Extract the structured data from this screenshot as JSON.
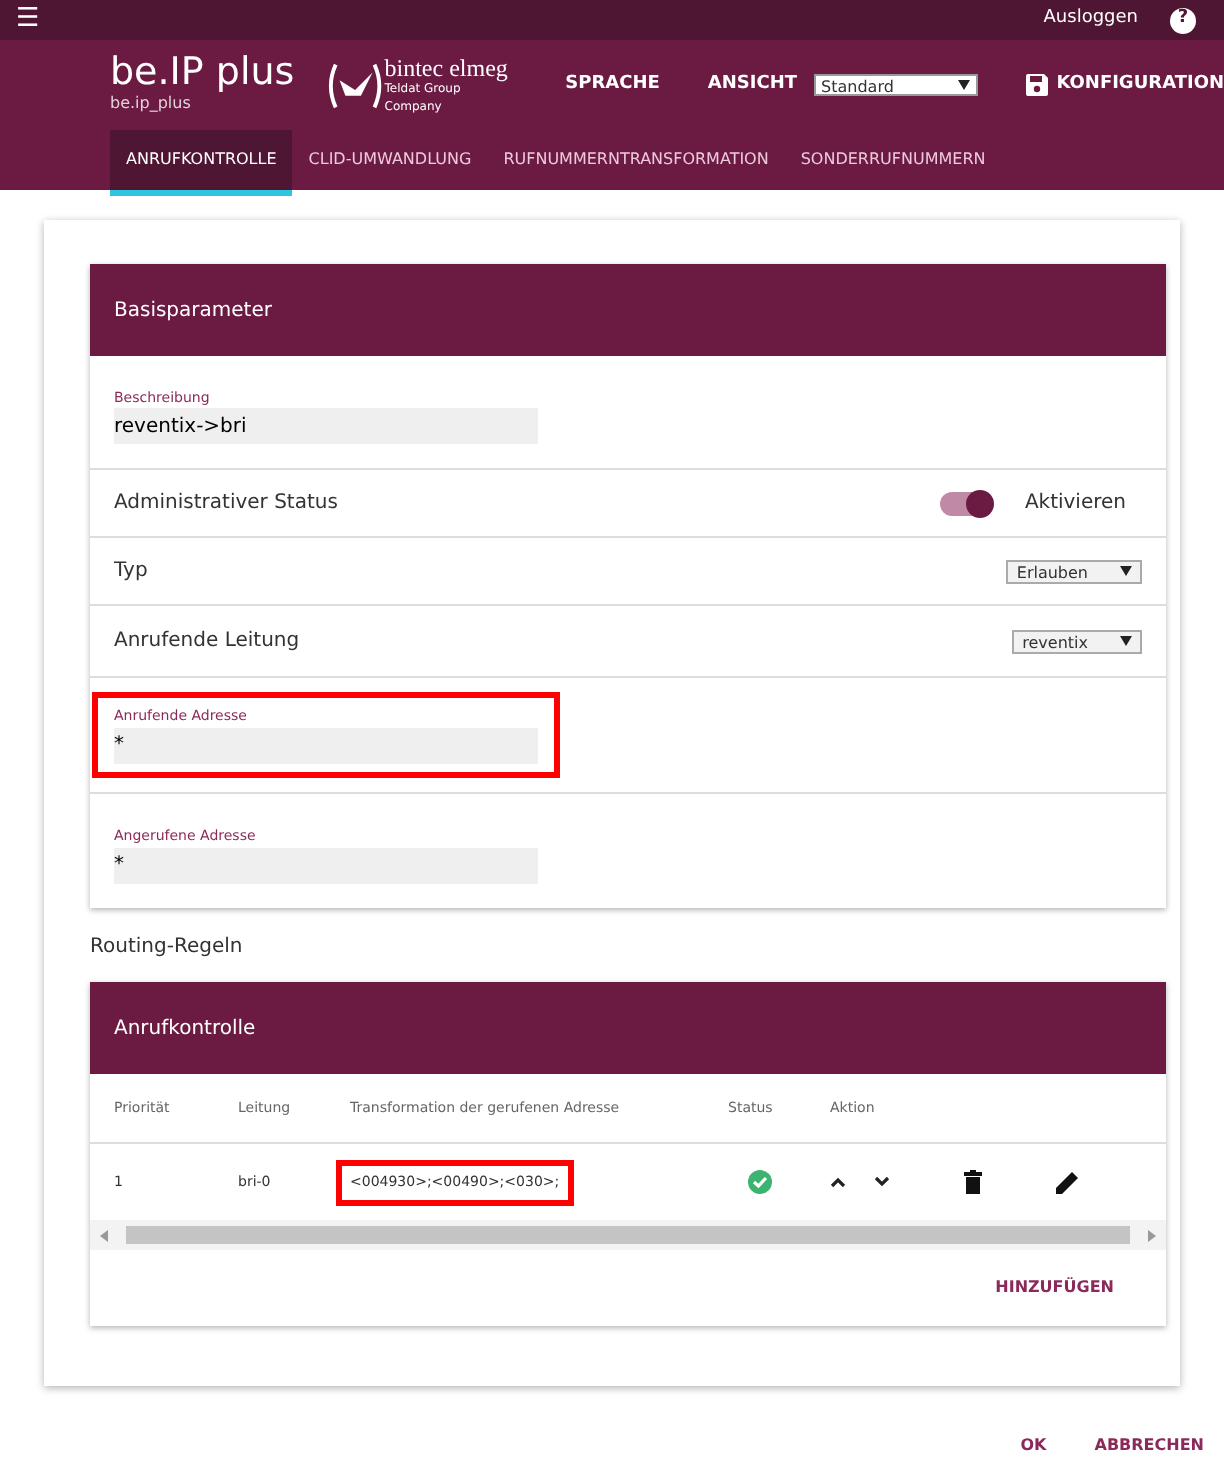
{
  "topbar": {
    "menu_icon": "☰",
    "logout": "Ausloggen",
    "help": "?"
  },
  "header": {
    "product": "be.IP plus",
    "hostname": "be.ip_plus",
    "brand": "bintec elmeg",
    "brand_sub": "Teldat Group Company",
    "language": "SPRACHE",
    "view_label": "ANSICHT",
    "view_value": "Standard",
    "config": "KONFIGURATION"
  },
  "tabs": [
    {
      "label": "ANRUFKONTROLLE",
      "selected": true
    },
    {
      "label": "CLID-UMWANDLUNG",
      "selected": false
    },
    {
      "label": "RUFNUMMERNTRANSFORMATION",
      "selected": false
    },
    {
      "label": "SONDERRUFNUMMERN",
      "selected": false
    }
  ],
  "basic": {
    "title": "Basisparameter",
    "rows": [
      {
        "kind": "text",
        "label": "Beschreibung",
        "value": "reventix->bri",
        "highlighted": false
      },
      {
        "kind": "toggle",
        "label": "Administrativer Status",
        "on": true,
        "option": "Aktivieren"
      },
      {
        "kind": "select",
        "label": "Typ",
        "value": "Erlauben"
      },
      {
        "kind": "select",
        "label": "Anrufende Leitung",
        "value": "reventix"
      },
      {
        "kind": "text",
        "label": "Anrufende Adresse",
        "value": "*",
        "highlighted": true
      },
      {
        "kind": "text",
        "label": "Angerufene Adresse",
        "value": "*",
        "highlighted": false
      }
    ]
  },
  "routing": {
    "heading": "Routing-Regeln",
    "title": "Anrufkontrolle",
    "columns": [
      "Priorität",
      "Leitung",
      "Transformation der gerufenen Adresse",
      "Status",
      "Aktion"
    ],
    "rows": [
      {
        "priority": "1",
        "line": "bri-0",
        "transformation": "<004930>;<00490>;<030>;",
        "highlighted": true,
        "active": true
      }
    ],
    "add": "HINZUFÜGEN"
  },
  "footer": {
    "ok": "OK",
    "cancel": "ABBRECHEN"
  }
}
